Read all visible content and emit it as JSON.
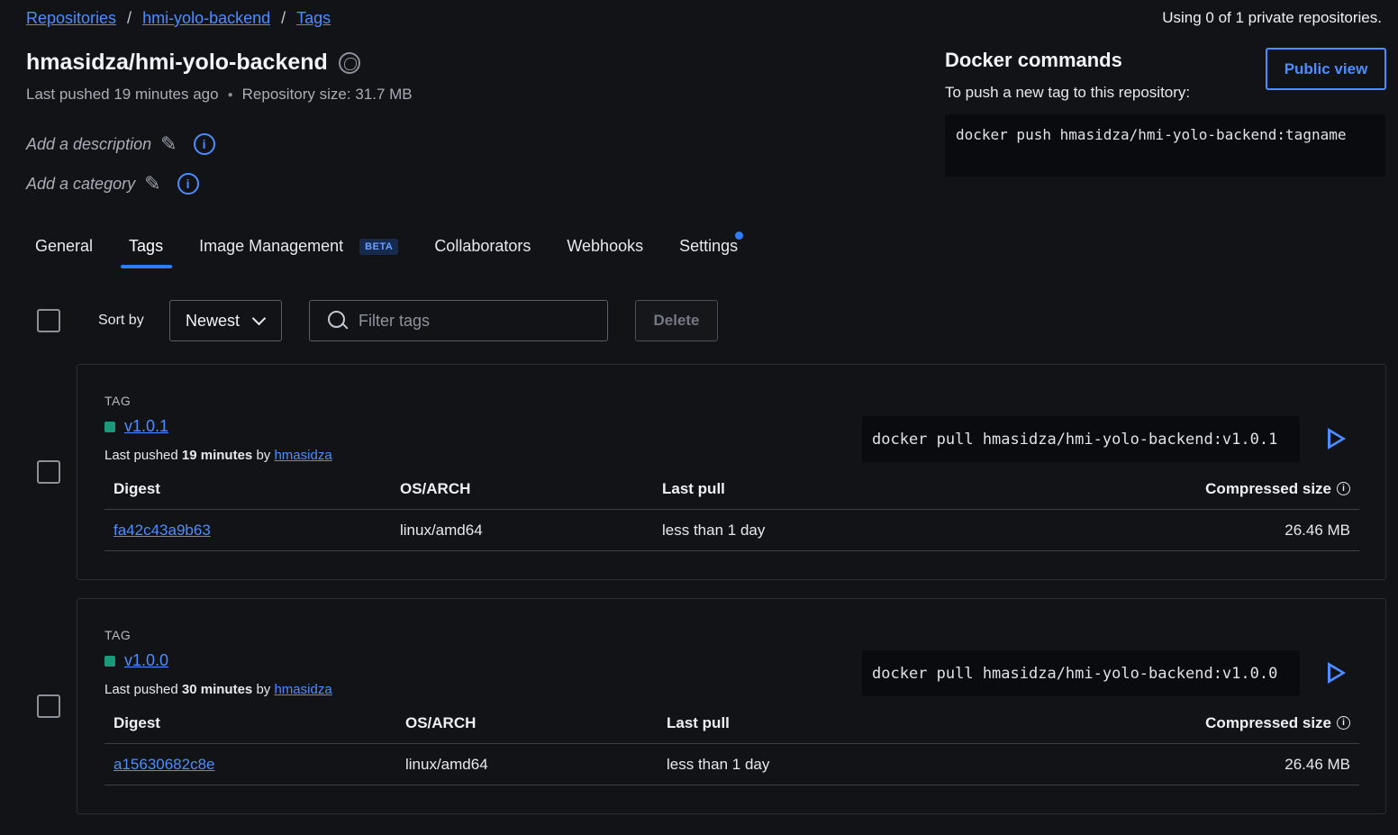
{
  "breadcrumb": {
    "items": [
      "Repositories",
      "hmi-yolo-backend",
      "Tags"
    ],
    "separator": "/"
  },
  "usage_text": "Using 0 of 1 private repositories.",
  "repo": {
    "title": "hmasidza/hmi-yolo-backend",
    "last_pushed": "Last pushed 19 minutes ago",
    "size": "Repository size: 31.7 MB",
    "add_description": "Add a description",
    "add_category": "Add a category"
  },
  "docker_commands": {
    "title": "Docker commands",
    "subtitle": "To push a new tag to this repository:",
    "push_command": "docker push hmasidza/hmi-yolo-backend:tagname",
    "public_view_label": "Public view"
  },
  "tabs": [
    {
      "label": "General"
    },
    {
      "label": "Tags",
      "active": true
    },
    {
      "label": "Image Management",
      "badge": "BETA"
    },
    {
      "label": "Collaborators"
    },
    {
      "label": "Webhooks"
    },
    {
      "label": "Settings",
      "notification": true
    }
  ],
  "toolbar": {
    "sort_label": "Sort by",
    "sort_value": "Newest",
    "filter_placeholder": "Filter tags",
    "delete_label": "Delete"
  },
  "tag_list": [
    {
      "section_label": "TAG",
      "name": "v1.0.1",
      "pushed_prefix": "Last pushed",
      "pushed_time": "19 minutes",
      "pushed_by": "by",
      "user": "hmasidza",
      "pull_command": "docker pull hmasidza/hmi-yolo-backend:v1.0.1",
      "headers": {
        "digest": "Digest",
        "os_arch": "OS/ARCH",
        "last_pull": "Last pull",
        "size": "Compressed size"
      },
      "row": {
        "digest": "fa42c43a9b63",
        "os_arch": "linux/amd64",
        "last_pull": "less than 1 day",
        "size": "26.46 MB"
      }
    },
    {
      "section_label": "TAG",
      "name": "v1.0.0",
      "pushed_prefix": "Last pushed",
      "pushed_time": "30 minutes",
      "pushed_by": "by",
      "user": "hmasidza",
      "pull_command": "docker pull hmasidza/hmi-yolo-backend:v1.0.0",
      "headers": {
        "digest": "Digest",
        "os_arch": "OS/ARCH",
        "last_pull": "Last pull",
        "size": "Compressed size"
      },
      "row": {
        "digest": "a15630682c8e",
        "os_arch": "linux/amd64",
        "last_pull": "less than 1 day",
        "size": "26.46 MB"
      }
    }
  ],
  "colors": {
    "accent": "#4d8dff",
    "tab_underline": "#2f7df6",
    "tag_status": "#1a9a7a",
    "background": "#111317"
  }
}
